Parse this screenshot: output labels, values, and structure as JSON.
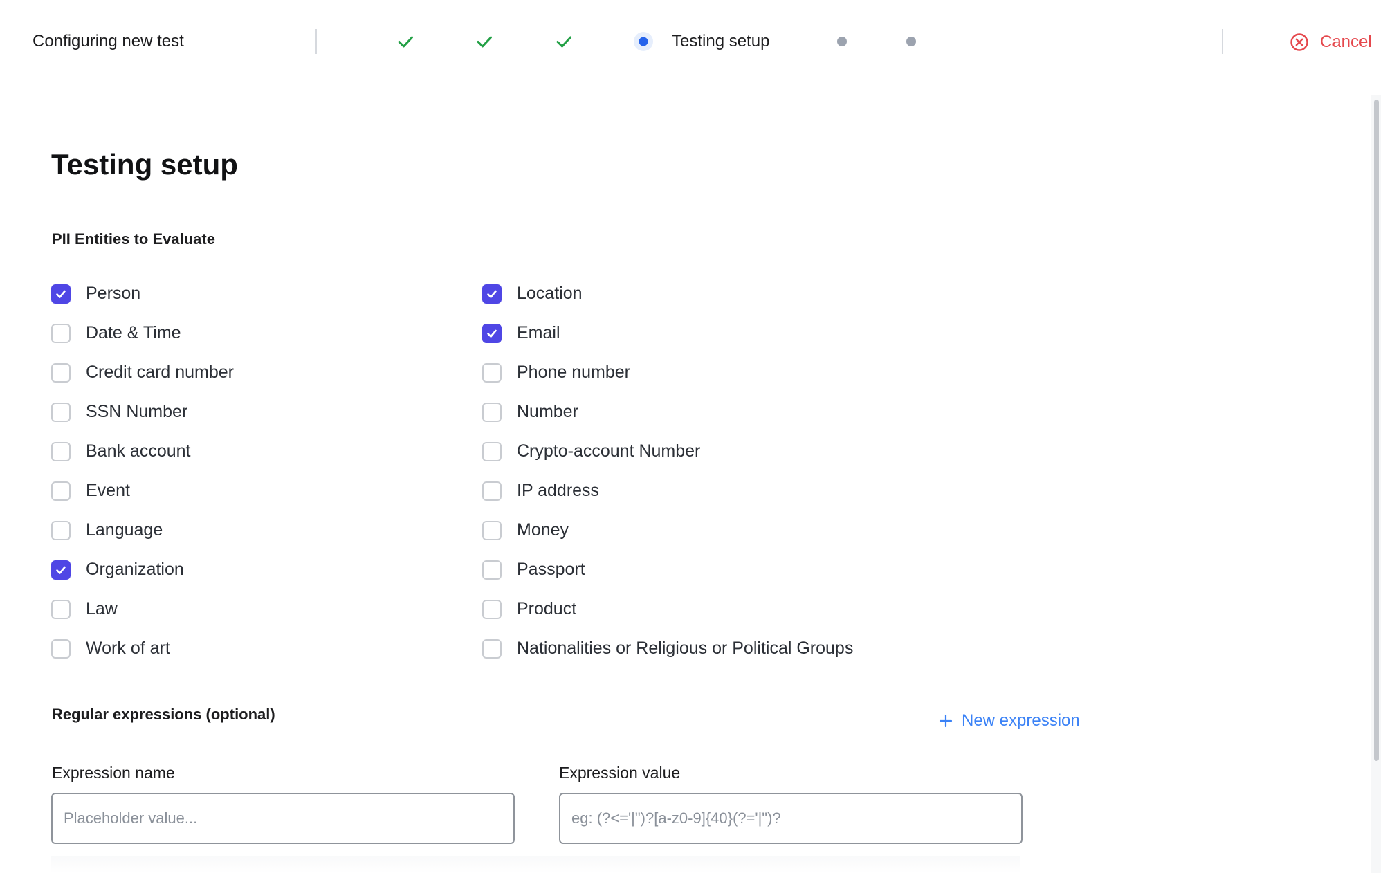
{
  "header": {
    "title": "Configuring new test",
    "current_step_label": "Testing setup",
    "cancel_label": "Cancel",
    "steps": [
      {
        "status": "done",
        "icon": "checkmark-icon"
      },
      {
        "status": "done",
        "icon": "checkmark-icon"
      },
      {
        "status": "done",
        "icon": "checkmark-icon"
      },
      {
        "status": "current",
        "icon": "current-step-dot-icon"
      },
      {
        "status": "pending",
        "icon": "pending-step-dot-icon"
      },
      {
        "status": "pending",
        "icon": "pending-step-dot-icon"
      }
    ]
  },
  "page": {
    "title": "Testing setup"
  },
  "pii": {
    "section_title": "PII Entities to Evaluate",
    "left_column": [
      {
        "label": "Person",
        "checked": true
      },
      {
        "label": "Date & Time",
        "checked": false
      },
      {
        "label": "Credit card number",
        "checked": false
      },
      {
        "label": "SSN Number",
        "checked": false
      },
      {
        "label": "Bank account",
        "checked": false
      },
      {
        "label": "Event",
        "checked": false
      },
      {
        "label": "Language",
        "checked": false
      },
      {
        "label": "Organization",
        "checked": true
      },
      {
        "label": "Law",
        "checked": false
      },
      {
        "label": "Work of art",
        "checked": false
      }
    ],
    "right_column": [
      {
        "label": "Location",
        "checked": true
      },
      {
        "label": "Email",
        "checked": true
      },
      {
        "label": "Phone number",
        "checked": false
      },
      {
        "label": "Number",
        "checked": false
      },
      {
        "label": "Crypto-account Number",
        "checked": false
      },
      {
        "label": "IP address",
        "checked": false
      },
      {
        "label": "Money",
        "checked": false
      },
      {
        "label": "Passport",
        "checked": false
      },
      {
        "label": "Product",
        "checked": false
      },
      {
        "label": "Nationalities or Religious or Political Groups",
        "checked": false
      }
    ]
  },
  "regex": {
    "section_title": "Regular expressions (optional)",
    "new_expression_label": "New expression",
    "name_label": "Expression name",
    "name_placeholder": "Placeholder value...",
    "name_value": "",
    "value_label": "Expression value",
    "value_placeholder": "eg: (?<='|\")?[a-z0-9]{40}(?='|\")?",
    "value_value": ""
  },
  "colors": {
    "accent": "#4f46e5",
    "success": "#22a045",
    "current_step": "#2563eb",
    "pending_step": "#9ca3af",
    "danger": "#e5484d",
    "link": "#3b82f6"
  }
}
